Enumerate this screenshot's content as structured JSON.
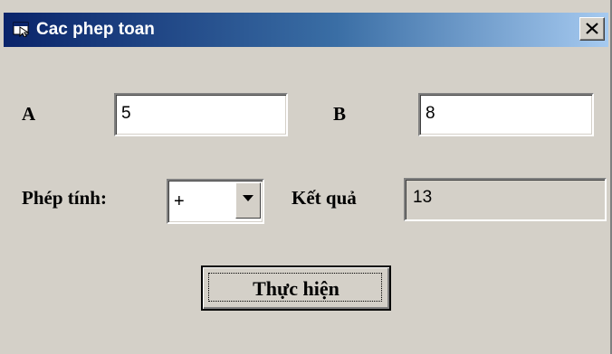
{
  "window": {
    "title": "Cac phep toan",
    "icon": "app-window-icon",
    "close_icon": "close-icon"
  },
  "form": {
    "label_a": "A",
    "value_a": "5",
    "label_b": "B",
    "value_b": "8",
    "label_operation": "Phép tính:",
    "operation_selected": "+",
    "label_result": "Kết quả",
    "result_value": "13",
    "execute_label": "Thực hiện"
  },
  "colors": {
    "titlebar_start": "#0a246a",
    "titlebar_end": "#a6caf0",
    "face": "#d4d0c8"
  }
}
